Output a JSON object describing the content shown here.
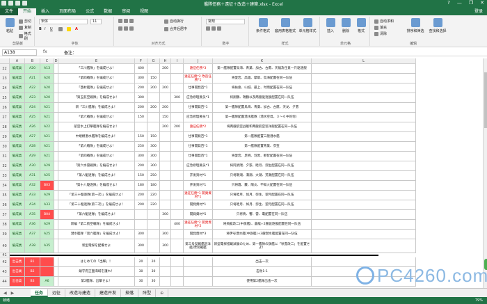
{
  "window": {
    "title": "艦隊任務＋遠征＋改造＋建築.xlsx - Excel",
    "controls": [
      "?",
      "—",
      "❐",
      "✕"
    ]
  },
  "tabs": [
    "文件",
    "开始",
    "插入",
    "页面布局",
    "公式",
    "数据",
    "审阅",
    "视图"
  ],
  "login_label": "登录",
  "ribbon": {
    "clipboard": {
      "paste": "粘贴",
      "cut": "剪切",
      "copy": "复制",
      "painter": "格式刷",
      "label": "剪贴板"
    },
    "font": {
      "name": "宋体",
      "size": "11",
      "label": "字体"
    },
    "alignment": {
      "wrap": "自动换行",
      "merge": "合并后居中",
      "label": "对齐方式"
    },
    "number": {
      "format": "常规",
      "label": "数字"
    },
    "styles": {
      "conditional": "条件格式",
      "table": "套用表格格式",
      "cell": "单元格样式",
      "label": "样式"
    },
    "cells": {
      "insert": "插入",
      "delete": "删除",
      "format": "格式",
      "label": "单元格"
    },
    "editing": {
      "autosum": "自动求和",
      "fill": "填充",
      "clear": "清除",
      "sort": "排序和筛选",
      "find": "查找和选择",
      "label": "编辑"
    }
  },
  "formula_bar": {
    "cell_ref": "A138",
    "fx": "fx",
    "content": "备注："
  },
  "columns": [
    "A",
    "B",
    "C",
    "D",
    "E",
    "F",
    "G",
    "H",
    "I",
    "J",
    "K",
    "L"
  ],
  "rows": [
    {
      "n": "22",
      "a": "編成类",
      "b": "A20",
      "c": "A13",
      "e": "「三川艦隊」を編成せよ！",
      "f": "400",
      "h": "200",
      "j": "遠征任務*3",
      "k": "第一艦隊配置鳥海、青葉、加古、古鷹、天龍及任意一只驱逐舰"
    },
    {
      "n": "23",
      "a": "編成类",
      "b": "A21",
      "c": "A20",
      "e": "「第四戦隊」を編成せよ！",
      "f": "300",
      "g": "150",
      "j": "遠征任務*2\n改造任務*1",
      "k": "将愛宕、高雄、摩耶、鳥海配置在同一队伍"
    },
    {
      "n": "24",
      "a": "編成类",
      "b": "A22",
      "c": "A20",
      "e": "「西村艦隊」を編成せよ！",
      "f": "200",
      "g": "200",
      "h": "200",
      "j": "仕事開発百*1",
      "k": "将扶桑、山城、最上、时雨配置在同一队伍"
    },
    {
      "n": "25",
      "a": "編成类",
      "b": "A23",
      "c": "A20",
      "e": "「第五航空戦隊」を編成せよ！",
      "f": "300",
      "i": "300",
      "j": "应急修理要员*1",
      "k": "将翔鶴、瑞鶴以及两艘驱逐舰配置在同一队伍"
    },
    {
      "n": "26",
      "a": "編成类",
      "b": "A24",
      "c": "A21",
      "e": "新「三川艦隊」を編成せよ！",
      "f": "200",
      "g": "200",
      "h": "200",
      "j": "仕事開発百*1",
      "k": "第一艦隊配置鳥海、青葉、加古、古鷹、天龙、夕張"
    },
    {
      "n": "27",
      "a": "編成类",
      "b": "A25",
      "c": "A21",
      "e": "「第六戦隊」を編成せよ！",
      "f": "150",
      "h": "150",
      "j": "应急修理要员*1",
      "k": "第一艦隊配置潜水艦隊（潜水空母，３～６中的何）"
    },
    {
      "n": "28",
      "a": "編成类",
      "b": "A26",
      "c": "A22",
      "e": "航空水上打撃艦隊を編成せよ！",
      "h": "200",
      "i": "200",
      "j": "遠征任務*2",
      "k": "将两艘航空战舰和两艘航空巡洋舰配置在同一队伍"
    },
    {
      "n": "29",
      "a": "編成类",
      "b": "A27",
      "c": "A21",
      "e": "中規模潜水艦隊を編成せよ！",
      "f": "150",
      "g": "150",
      "j": "仕事開発百*1",
      "k": "第一艦隊配置三艘潜水艦"
    },
    {
      "n": "30",
      "a": "編成类",
      "b": "A28",
      "c": "A21",
      "e": "「第六戦隊」を編成せよ！",
      "f": "250",
      "g": "300",
      "j": "仕事開発百*1",
      "k": "第一艦隊配置青葉、衣笠"
    },
    {
      "n": "31",
      "a": "編成类",
      "b": "A29",
      "c": "A21",
      "e": "「第四戦隊」を編成せよ！",
      "f": "300",
      "g": "300",
      "j": "仕事開発百*1",
      "k": "将愛宕、足柄、羽黒、那智配置在同一队伍"
    },
    {
      "n": "32",
      "a": "編成类",
      "b": "A30",
      "c": "A29",
      "e": "「第六水雷戦隊」を編成せよ！",
      "f": "200",
      "g": "300",
      "j": "应急修理要员*1",
      "k": "将阿武隈、夕張、睦月、弥生配置在同一队伍"
    },
    {
      "n": "33",
      "a": "編成类",
      "b": "A31",
      "c": "A25",
      "e": "「第八駆逐隊」を編成せよ！",
      "f": "150",
      "g": "250",
      "j": "开发资材*1",
      "k": "只将朝潮、満潮、大潮、荒潮配置在同一队伍"
    },
    {
      "n": "34",
      "a": "編成类",
      "b": "A32",
      "c": "B03",
      "e": "「第十八駆逐隊」を編成せよ！",
      "f": "180",
      "g": "180",
      "j": "开发资材*1",
      "k": "只将霞、霰、陽炎、不知火配置在同一队伍"
    },
    {
      "n": "35",
      "a": "編成类",
      "b": "A33",
      "c": "A29",
      "e": "「第三十駆逐隊(第一次)」を編成せよ！",
      "f": "200",
      "g": "220",
      "j": "遠征任務*1\n開発資材*1",
      "k": "只将睦月、如月、弥生、望月配置在同一队伍"
    },
    {
      "n": "36",
      "a": "編成类",
      "b": "A34",
      "c": "A33",
      "e": "「第三十駆逐隊(第二次)」を編成せよ！",
      "f": "200",
      "g": "220",
      "j": "開発資材*1",
      "k": "只将睦月、如月、弥生、望月配置在同一队伍"
    },
    {
      "n": "37",
      "a": "編成类",
      "b": "A35",
      "c": "B04",
      "e": "「第六駆逐隊」を編成せよ！",
      "h": "300",
      "j": "開発資材*5",
      "k": "只将暁、響、雷、電配置在同一队伍"
    },
    {
      "n": "38",
      "a": "編成类",
      "b": "A36",
      "c": "A29",
      "e": "新編「第二航空戦隊」を編成せよ！",
      "i": "400",
      "j": "遠征任務*2\n開発資材*2",
      "k": "将飛龍改二(中旗艦)、蒼龍+2艘驱逐舰配置在同一队伍"
    },
    {
      "n": "39",
      "a": "編成类",
      "b": "A37",
      "c": "A25",
      "e": "潜水艦隊「第六艦隊」を編成せよ！",
      "f": "300",
      "h": "300",
      "j": "開発資材*3",
      "k": "将伊号潜水艦(中旗艦)+3艘潜水艦配置在同一队伍"
    },
    {
      "n": "40",
      "a": "編成类",
      "b": "A38",
      "c": "A35",
      "e": "新型電探を配備せよ",
      "f": "300",
      "h": "300",
      "j": "第三号型戦艦巡洋艦/改装戦艦",
      "k": "新型電探搭載試験のため、第一艦隊の旗艦に「秋雲改二」を配置せよ！"
    },
    {
      "n": "42",
      "a": "出击类",
      "b": "B1",
      "e": "はじめての「出撃」！",
      "f": "20",
      "g": "20",
      "j": "",
      "k": "出击一次"
    },
    {
      "n": "43",
      "a": "出击类",
      "b": "B2",
      "e": "鎮守府正面海域を護れ！",
      "f": "30",
      "g": "30",
      "j": "",
      "k": "击败1-1"
    },
    {
      "n": "44",
      "a": "出击类",
      "b": "B3",
      "c": "A6",
      "e": "第2艦隊、出撃せよ！",
      "f": "30",
      "g": "30",
      "j": "",
      "k": "使用第2艦隊出击一次"
    }
  ],
  "sheets": [
    "任务",
    "远征",
    "改造与建造",
    "建造开发",
    "掉落",
    "阵型"
  ],
  "active_sheet": "任务",
  "status": {
    "ready": "就绪",
    "zoom": "79%"
  },
  "watermark": "PC4260.com"
}
